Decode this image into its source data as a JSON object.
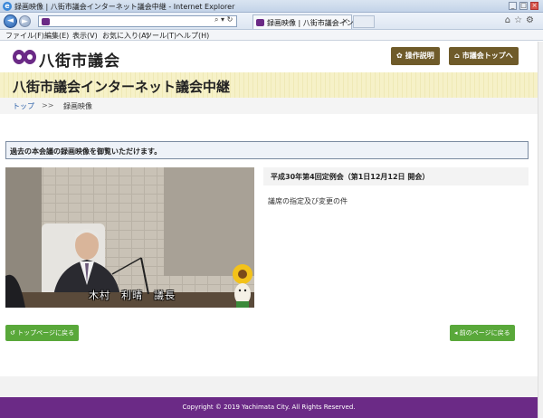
{
  "browser": {
    "window_title": "録画映像 | 八街市議会インターネット議会中継 - Internet Explorer",
    "tab_title": "録画映像 | 八街市議会イン...",
    "menu": [
      "ファイル(F)",
      "編集(E)",
      "表示(V)",
      "お気に入り(A)",
      "ツール(T)",
      "ヘルプ(H)"
    ]
  },
  "header": {
    "logo_text": "八街市議会",
    "help_button": "操作説明",
    "top_button": "市議会トップへ"
  },
  "banner": {
    "title": "八街市議会インターネット議会中継"
  },
  "breadcrumb": {
    "home": "トップ",
    "separator": ">>",
    "current": "録画映像"
  },
  "notice": "過去の本会議の録画映像を御覧いただけます。",
  "video": {
    "caption": "木村　利晴　議長"
  },
  "session": {
    "title": "平成30年第4回定例会（第1日12月12日 開会）",
    "agenda": "議席の指定及び変更の件"
  },
  "buttons": {
    "back_top": "トップページに戻る",
    "back_prev": "前のページに戻る"
  },
  "footer": {
    "copyright": "Copyright © 2019 Yachimata City. All Rights Reserved."
  },
  "colors": {
    "brand_purple": "#6b2a86",
    "brown": "#6f5b2a",
    "green": "#59a83a",
    "banner": "#f6f1c8"
  }
}
